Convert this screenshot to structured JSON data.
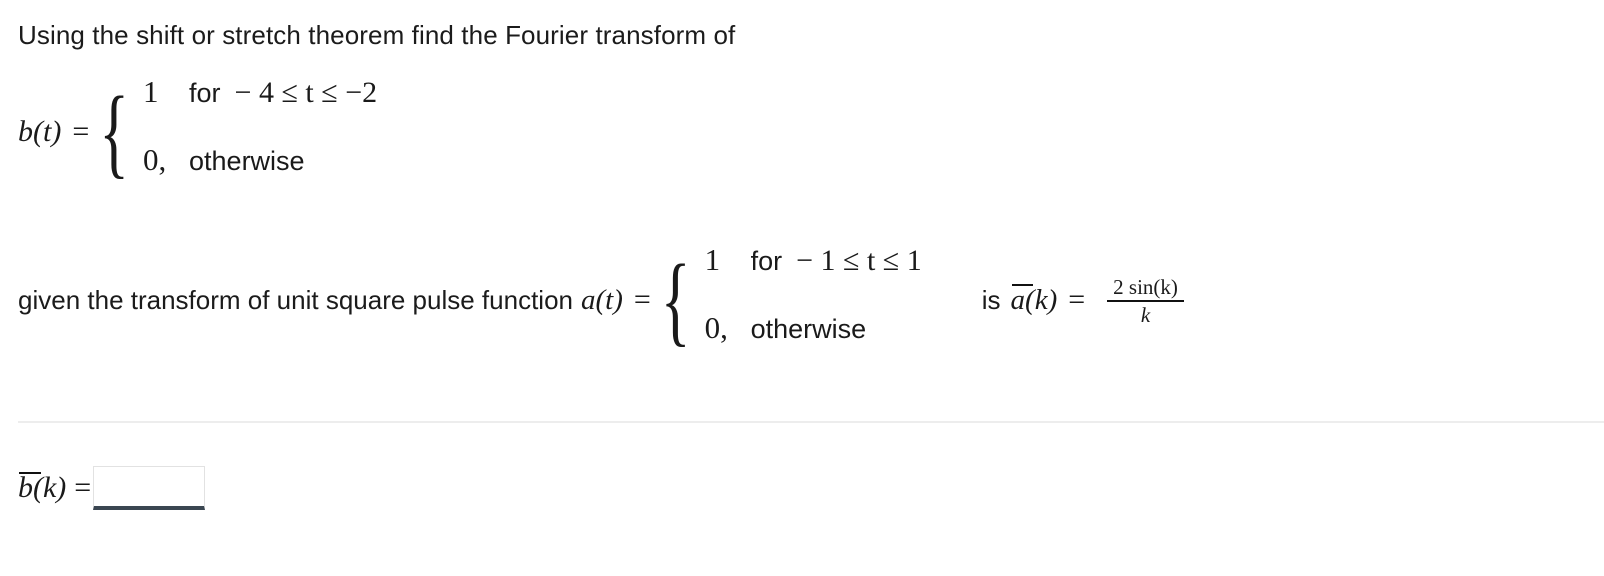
{
  "prompt": {
    "text": "Using the shift or stretch theorem find the Fourier transform of"
  },
  "definition_b": {
    "func_label": "b(t)",
    "equals": "=",
    "brace": "{",
    "case1_value": "1",
    "case1_for": "for",
    "case1_condition": "− 4 ≤ t ≤ −2",
    "case2_value": "0,",
    "case2_condition": "otherwise"
  },
  "given": {
    "lead_text": "given the transform of unit square pulse function",
    "func_label": "a(t)",
    "equals": "=",
    "brace": "{",
    "case1_value": "1",
    "case1_for": "for",
    "case1_condition": "− 1 ≤ t ≤ 1",
    "case2_value": "0,",
    "case2_condition": "otherwise",
    "is_word": "is",
    "transform_label": "a(k)",
    "transform_equals": "=",
    "fraction_numerator": "2 sin(k)",
    "fraction_denominator": "k"
  },
  "answer": {
    "label": "b(k)",
    "equals": "=",
    "input_value": "",
    "input_placeholder": ""
  },
  "colors": {
    "text": "#1b1b1b",
    "divider": "#ededed",
    "input_border": "#e2e2e2",
    "input_underline": "#3a4651",
    "background": "#ffffff"
  }
}
